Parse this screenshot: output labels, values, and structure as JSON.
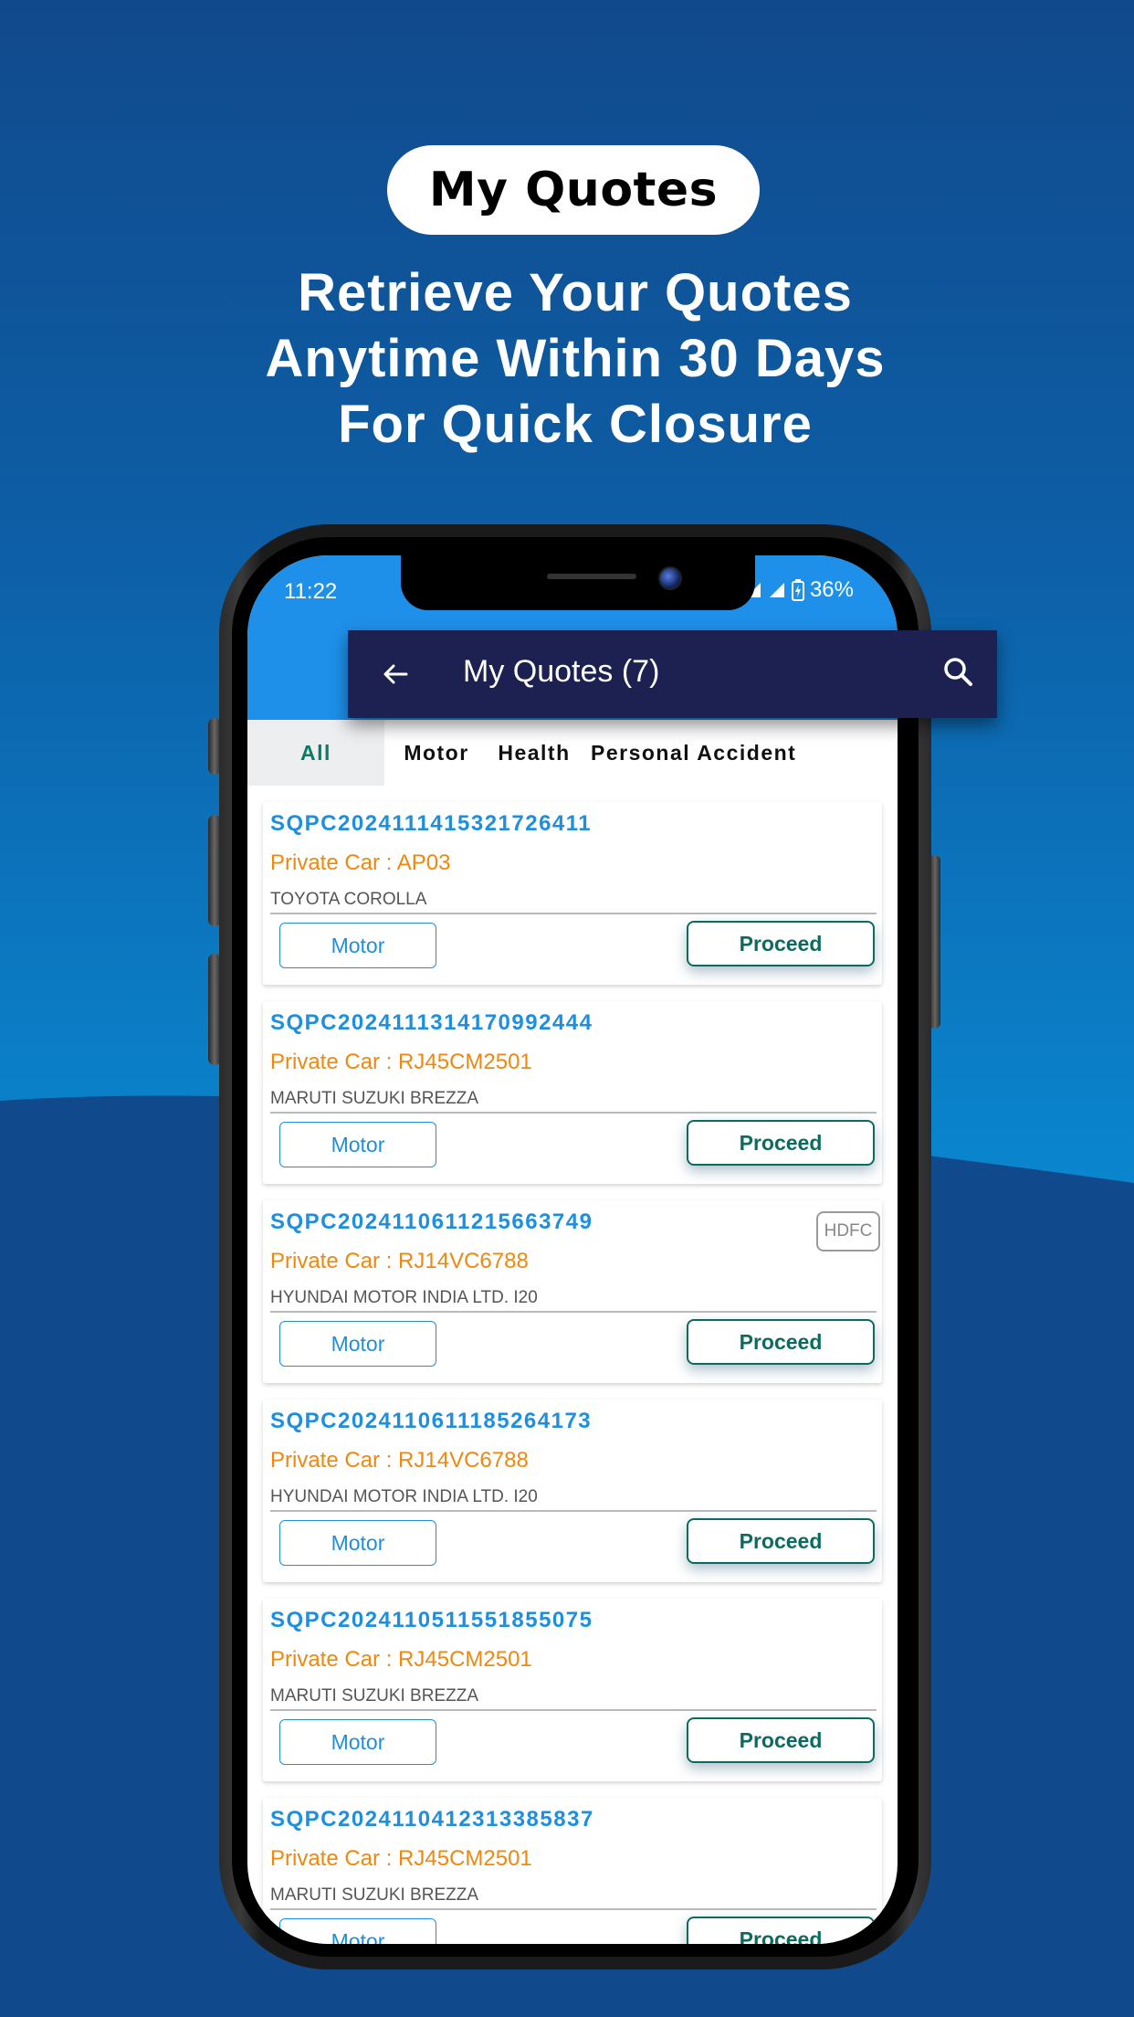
{
  "promo": {
    "pill_label": "My Quotes",
    "headline_lines": [
      "Retrieve Your Quotes",
      "Anytime Within 30 Days",
      "For Quick Closure"
    ]
  },
  "status_bar": {
    "time": "11:22",
    "battery": "36%",
    "icons": [
      "signal-icon",
      "signal-icon",
      "battery-charging-icon"
    ]
  },
  "app_bar": {
    "back_icon": "arrow-left-icon",
    "title": "My Quotes (7)",
    "search_icon": "search-icon"
  },
  "tabs": [
    {
      "label": "All",
      "active": true
    },
    {
      "label": "Motor",
      "active": false
    },
    {
      "label": "Health",
      "active": false
    },
    {
      "label": "Personal Accident",
      "active": false
    }
  ],
  "quotes": [
    {
      "id": "SQPC2024111415321726411",
      "vehicle": "Private Car : AP03",
      "model": "TOYOTA COROLLA",
      "type": "Motor",
      "action": "Proceed",
      "insurer": null
    },
    {
      "id": "SQPC2024111314170992444",
      "vehicle": "Private Car : RJ45CM2501",
      "model": "MARUTI SUZUKI BREZZA",
      "type": "Motor",
      "action": "Proceed",
      "insurer": null
    },
    {
      "id": "SQPC2024110611215663749",
      "vehicle": "Private Car : RJ14VC6788",
      "model": "HYUNDAI MOTOR INDIA LTD. I20",
      "type": "Motor",
      "action": "Proceed",
      "insurer": "HDFC"
    },
    {
      "id": "SQPC2024110611185264173",
      "vehicle": "Private Car : RJ14VC6788",
      "model": "HYUNDAI MOTOR INDIA LTD. I20",
      "type": "Motor",
      "action": "Proceed",
      "insurer": null
    },
    {
      "id": "SQPC2024110511551855075",
      "vehicle": "Private Car : RJ45CM2501",
      "model": "MARUTI SUZUKI BREZZA",
      "type": "Motor",
      "action": "Proceed",
      "insurer": null
    },
    {
      "id": "SQPC2024110412313385837",
      "vehicle": "Private Car : RJ45CM2501",
      "model": "MARUTI SUZUKI BREZZA",
      "type": "Motor",
      "action": "Proceed",
      "insurer": null
    }
  ],
  "colors": {
    "background": "#114a8c",
    "status_bar": "#1e90ea",
    "app_bar": "#1d2152",
    "quote_id": "#1e8fe0",
    "vehicle_text": "#f0870f",
    "proceed": "#0b6b5e",
    "active_tab": "#0b7a62"
  }
}
